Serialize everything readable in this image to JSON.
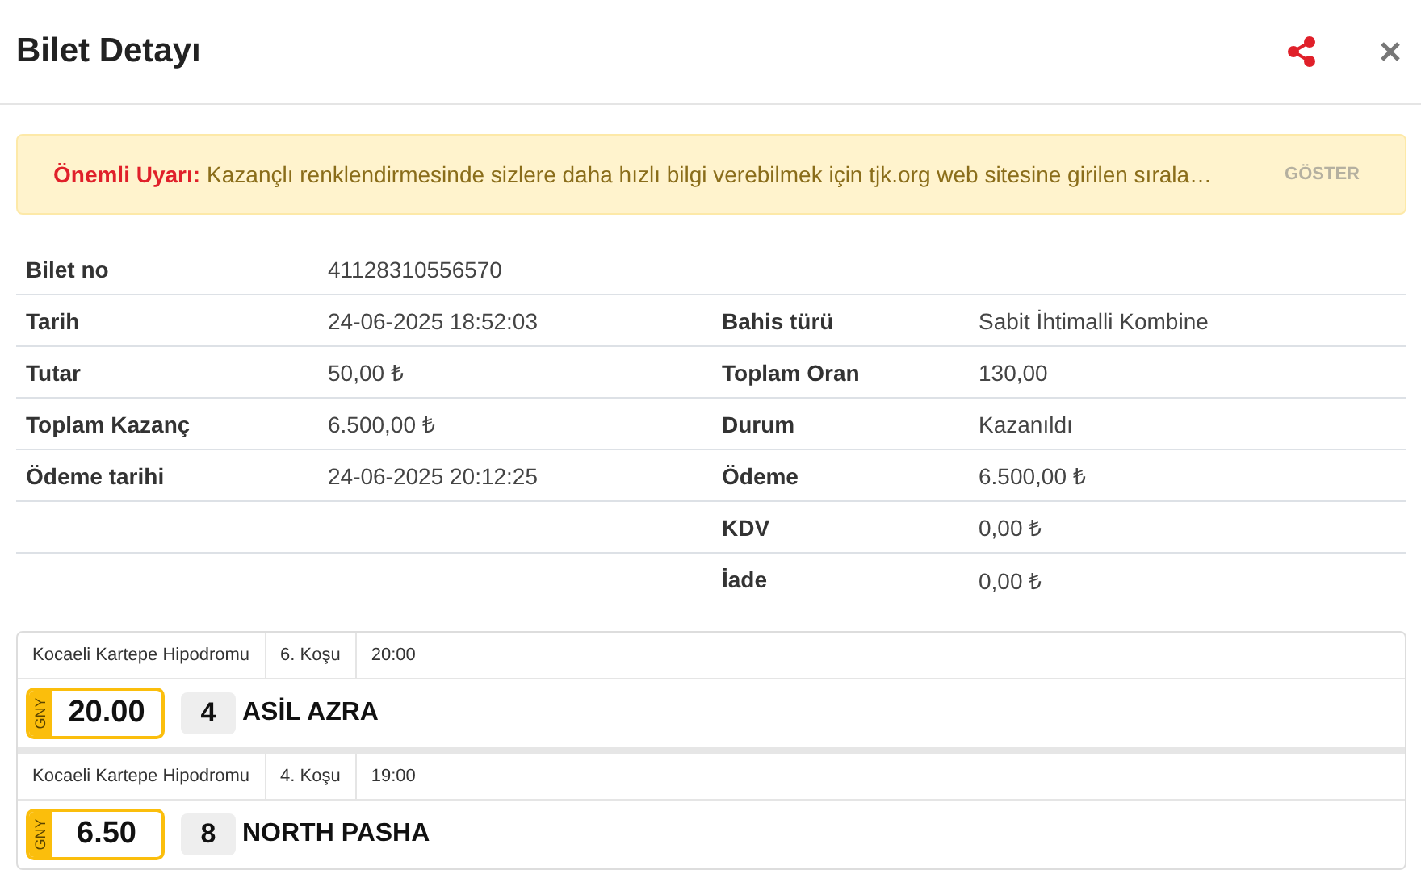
{
  "header": {
    "title": "Bilet Detayı"
  },
  "alert": {
    "label": "Önemli Uyarı:",
    "message": "Kazançlı renklendirmesinde sizlere daha hızlı bilgi verebilmek için tjk.org web sitesine girilen sırala…",
    "action": "GÖSTER"
  },
  "details": [
    {
      "left": {
        "label": "Bilet no",
        "value": "41128310556570"
      }
    },
    {
      "left": {
        "label": "Tarih",
        "value": "24-06-2025 18:52:03"
      },
      "right": {
        "label": "Bahis türü",
        "value": "Sabit İhtimalli Kombine"
      }
    },
    {
      "left": {
        "label": "Tutar",
        "value": "50,00 ₺"
      },
      "right": {
        "label": "Toplam Oran",
        "value": "130,00"
      }
    },
    {
      "left": {
        "label": "Toplam Kazanç",
        "value": "6.500,00 ₺"
      },
      "right": {
        "label": "Durum",
        "value": "Kazanıldı"
      }
    },
    {
      "left": {
        "label": "Ödeme tarihi",
        "value": "24-06-2025 20:12:25"
      },
      "right": {
        "label": "Ödeme",
        "value": "6.500,00 ₺"
      }
    },
    {
      "right": {
        "label": "KDV",
        "value": "0,00 ₺"
      }
    },
    {
      "right": {
        "label": "İade",
        "value": "0,00 ₺"
      }
    }
  ],
  "selections": [
    {
      "venue": "Kocaeli Kartepe Hipodromu",
      "race": "6. Koşu",
      "time": "20:00",
      "bet_type": "GNY",
      "odds": "20.00",
      "number": "4",
      "horse": "ASİL AZRA"
    },
    {
      "venue": "Kocaeli Kartepe Hipodromu",
      "race": "4. Koşu",
      "time": "19:00",
      "bet_type": "GNY",
      "odds": "6.50",
      "number": "8",
      "horse": "NORTH PASHA"
    }
  ]
}
